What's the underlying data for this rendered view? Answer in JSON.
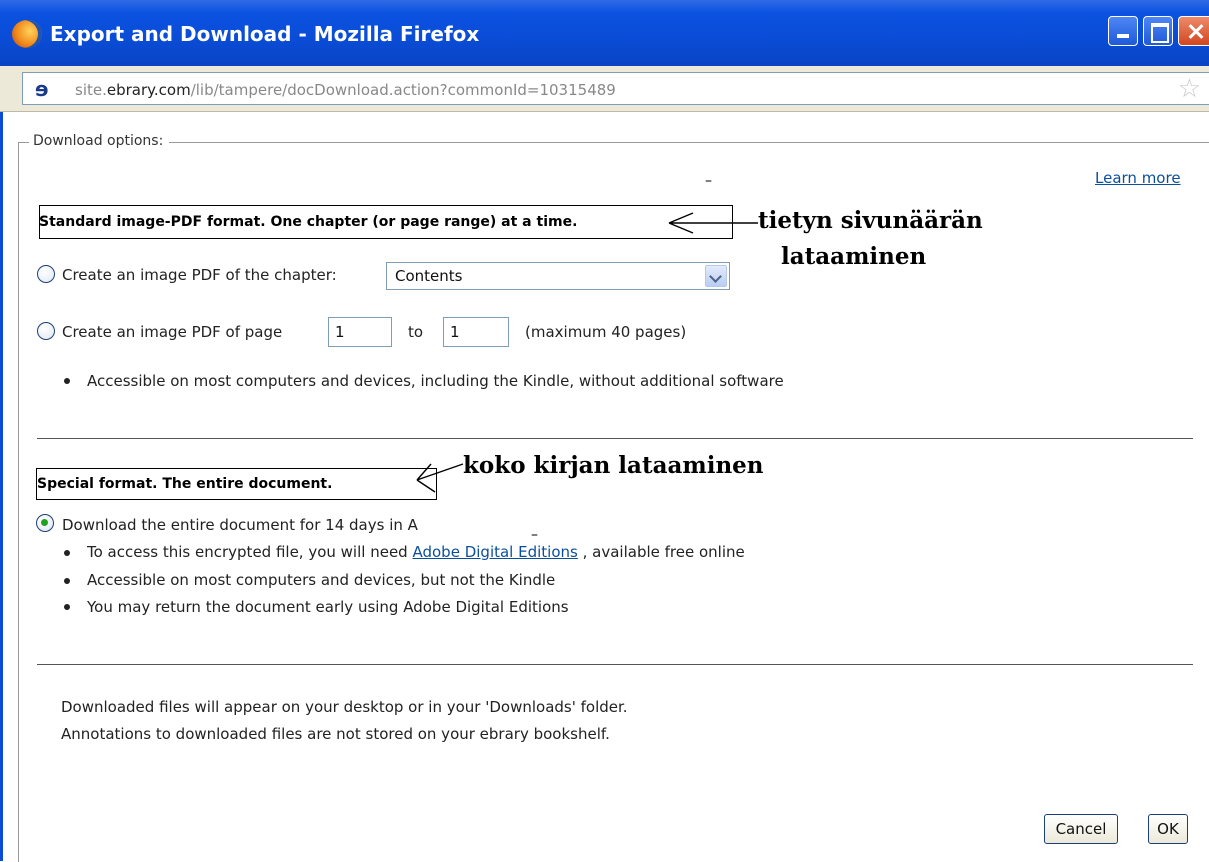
{
  "window": {
    "title": "Export and Download - Mozilla Firefox"
  },
  "addressbar": {
    "url_prefix": "site.",
    "url_domain": "ebrary.com",
    "url_path": "/lib/tampere/docDownload.action?commonId=10315489"
  },
  "panel": {
    "legend": "Download options:",
    "learn_more": "Learn more"
  },
  "standard": {
    "heading": "Standard image-PDF format. One chapter (or page range) at a time.",
    "annotation_line1": "tietyn sivunäärän",
    "annotation_line2": "lataaminen",
    "option_chapter_label": "Create an image PDF of the chapter:",
    "chapter_selected": "Contents",
    "option_pages_label": "Create an image PDF of page",
    "page_from": "1",
    "to_label": "to",
    "page_to": "1",
    "max_note": "(maximum 40 pages)",
    "bullet_1": "Accessible on most computers and devices, including the Kindle, without additional software"
  },
  "special": {
    "heading": "Special format. The entire document.",
    "annotation": "koko kirjan lataaminen",
    "option_label": "Download the entire document for 14 days in A",
    "bullet_1_prefix": "To access this encrypted file, you will need",
    "bullet_1_link": "Adobe Digital Editions",
    "bullet_1_suffix": ", available free online",
    "bullet_2": "Accessible on most computers and devices, but not the Kindle",
    "bullet_3": "You may return the document early using Adobe Digital Editions"
  },
  "notes": {
    "line_1": "Downloaded files will appear on your desktop or in your 'Downloads' folder.",
    "line_2": "Annotations to downloaded files are not stored on your ebrary bookshelf."
  },
  "buttons": {
    "cancel": "Cancel",
    "ok": "OK"
  }
}
